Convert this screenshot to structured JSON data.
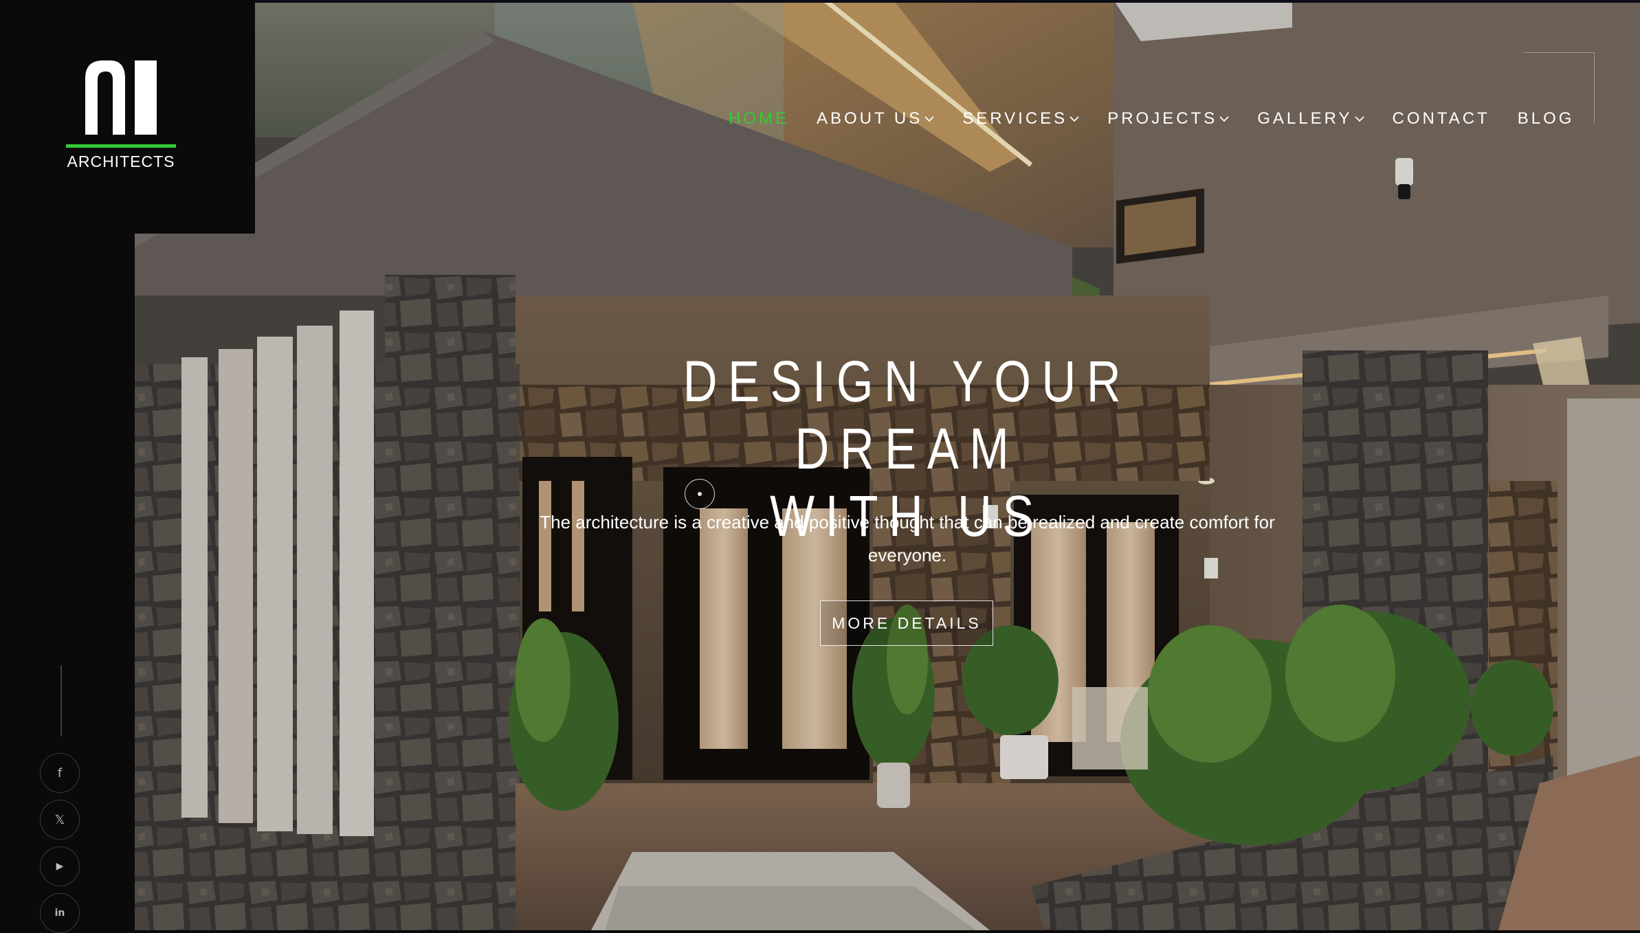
{
  "brand": {
    "logo_text": "ARCHITECTS",
    "accent_color": "#33cc33"
  },
  "nav": {
    "items": [
      {
        "label": "HOME",
        "active": true,
        "dropdown": false
      },
      {
        "label": "ABOUT US",
        "active": false,
        "dropdown": true
      },
      {
        "label": "SERVICES",
        "active": false,
        "dropdown": true
      },
      {
        "label": "PROJECTS",
        "active": false,
        "dropdown": true
      },
      {
        "label": "GALLERY",
        "active": false,
        "dropdown": true
      },
      {
        "label": "CONTACT",
        "active": false,
        "dropdown": false
      },
      {
        "label": "BLOG",
        "active": false,
        "dropdown": false
      }
    ],
    "dropdown_icon": "chevron-down-icon"
  },
  "hero": {
    "title_line1": "DESIGN YOUR DREAM",
    "title_line2": "WITH US",
    "subtitle": "The architecture is a creative and positive thought that can be realized and create comfort for everyone.",
    "button_label": "MORE DETAILS"
  },
  "social": [
    {
      "icon": "facebook-icon",
      "glyph": "f"
    },
    {
      "icon": "x-twitter-icon",
      "glyph": "𝕏"
    },
    {
      "icon": "youtube-icon",
      "glyph": "▶"
    },
    {
      "icon": "linkedin-icon",
      "glyph": "in"
    }
  ],
  "colors": {
    "sidebar": "#0a0a0b",
    "text": "#ffffff",
    "active_nav": "#33cc33"
  }
}
